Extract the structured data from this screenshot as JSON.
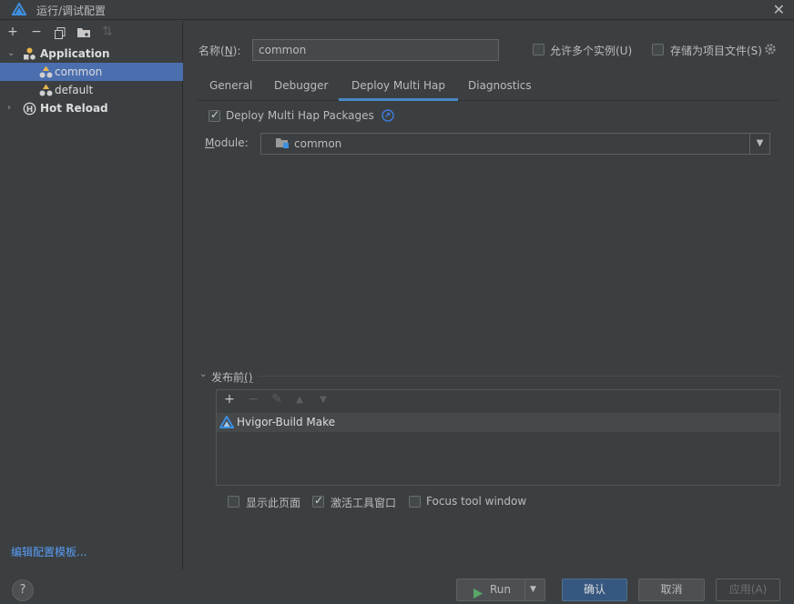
{
  "window": {
    "title": "运行/调试配置",
    "close_icon": "close-icon"
  },
  "left_toolbar": {
    "icons": [
      "add-icon",
      "remove-icon",
      "copy-icon",
      "new-folder-icon",
      "sort-icon"
    ]
  },
  "tree": {
    "items": [
      {
        "label": "Application",
        "icon": "application-icon",
        "expanded": true
      },
      {
        "label": "common",
        "icon": "harmony-module-icon",
        "selected": true
      },
      {
        "label": "default",
        "icon": "harmony-module-icon"
      },
      {
        "label": "Hot Reload",
        "icon": "hot-reload-icon",
        "expanded": false
      }
    ]
  },
  "edit_templates_link": "编辑配置模板...",
  "name_field": {
    "label_prefix": "名称(",
    "label_mnemonic": "N",
    "label_suffix": "):",
    "value": "common"
  },
  "options": {
    "allow_multiple": "允许多个实例(U)",
    "store_as_file": "存储为项目文件(S)"
  },
  "tabs": [
    {
      "label": "General"
    },
    {
      "label": "Debugger"
    },
    {
      "label": "Deploy Multi Hap",
      "active": true
    },
    {
      "label": "Diagnostics"
    }
  ],
  "deploy": {
    "checkbox_label": "Deploy Multi Hap Packages",
    "checked": true,
    "module_label_mnemonic": "M",
    "module_label_rest": "odule:",
    "module_value": "common"
  },
  "before_launch": {
    "title_text": "发布前",
    "title_mnemonic": "()",
    "tasks": [
      {
        "label": "Hvigor-Build Make",
        "icon": "hvigor-icon"
      }
    ]
  },
  "bottom_options": {
    "show_page": "显示此页面",
    "show_page_checked": false,
    "activate_tool_window": "激活工具窗口",
    "activate_tool_window_checked": true,
    "focus_tool_window": "Focus tool window",
    "focus_tool_window_checked": false
  },
  "buttons": {
    "help": "?",
    "run": "Run",
    "ok": "确认",
    "cancel": "取消",
    "apply": "应用(A)"
  },
  "colors": {
    "accent": "#4b6eaf",
    "primary_button": "#365880",
    "link": "#589df6",
    "run_icon": "#59a869"
  }
}
